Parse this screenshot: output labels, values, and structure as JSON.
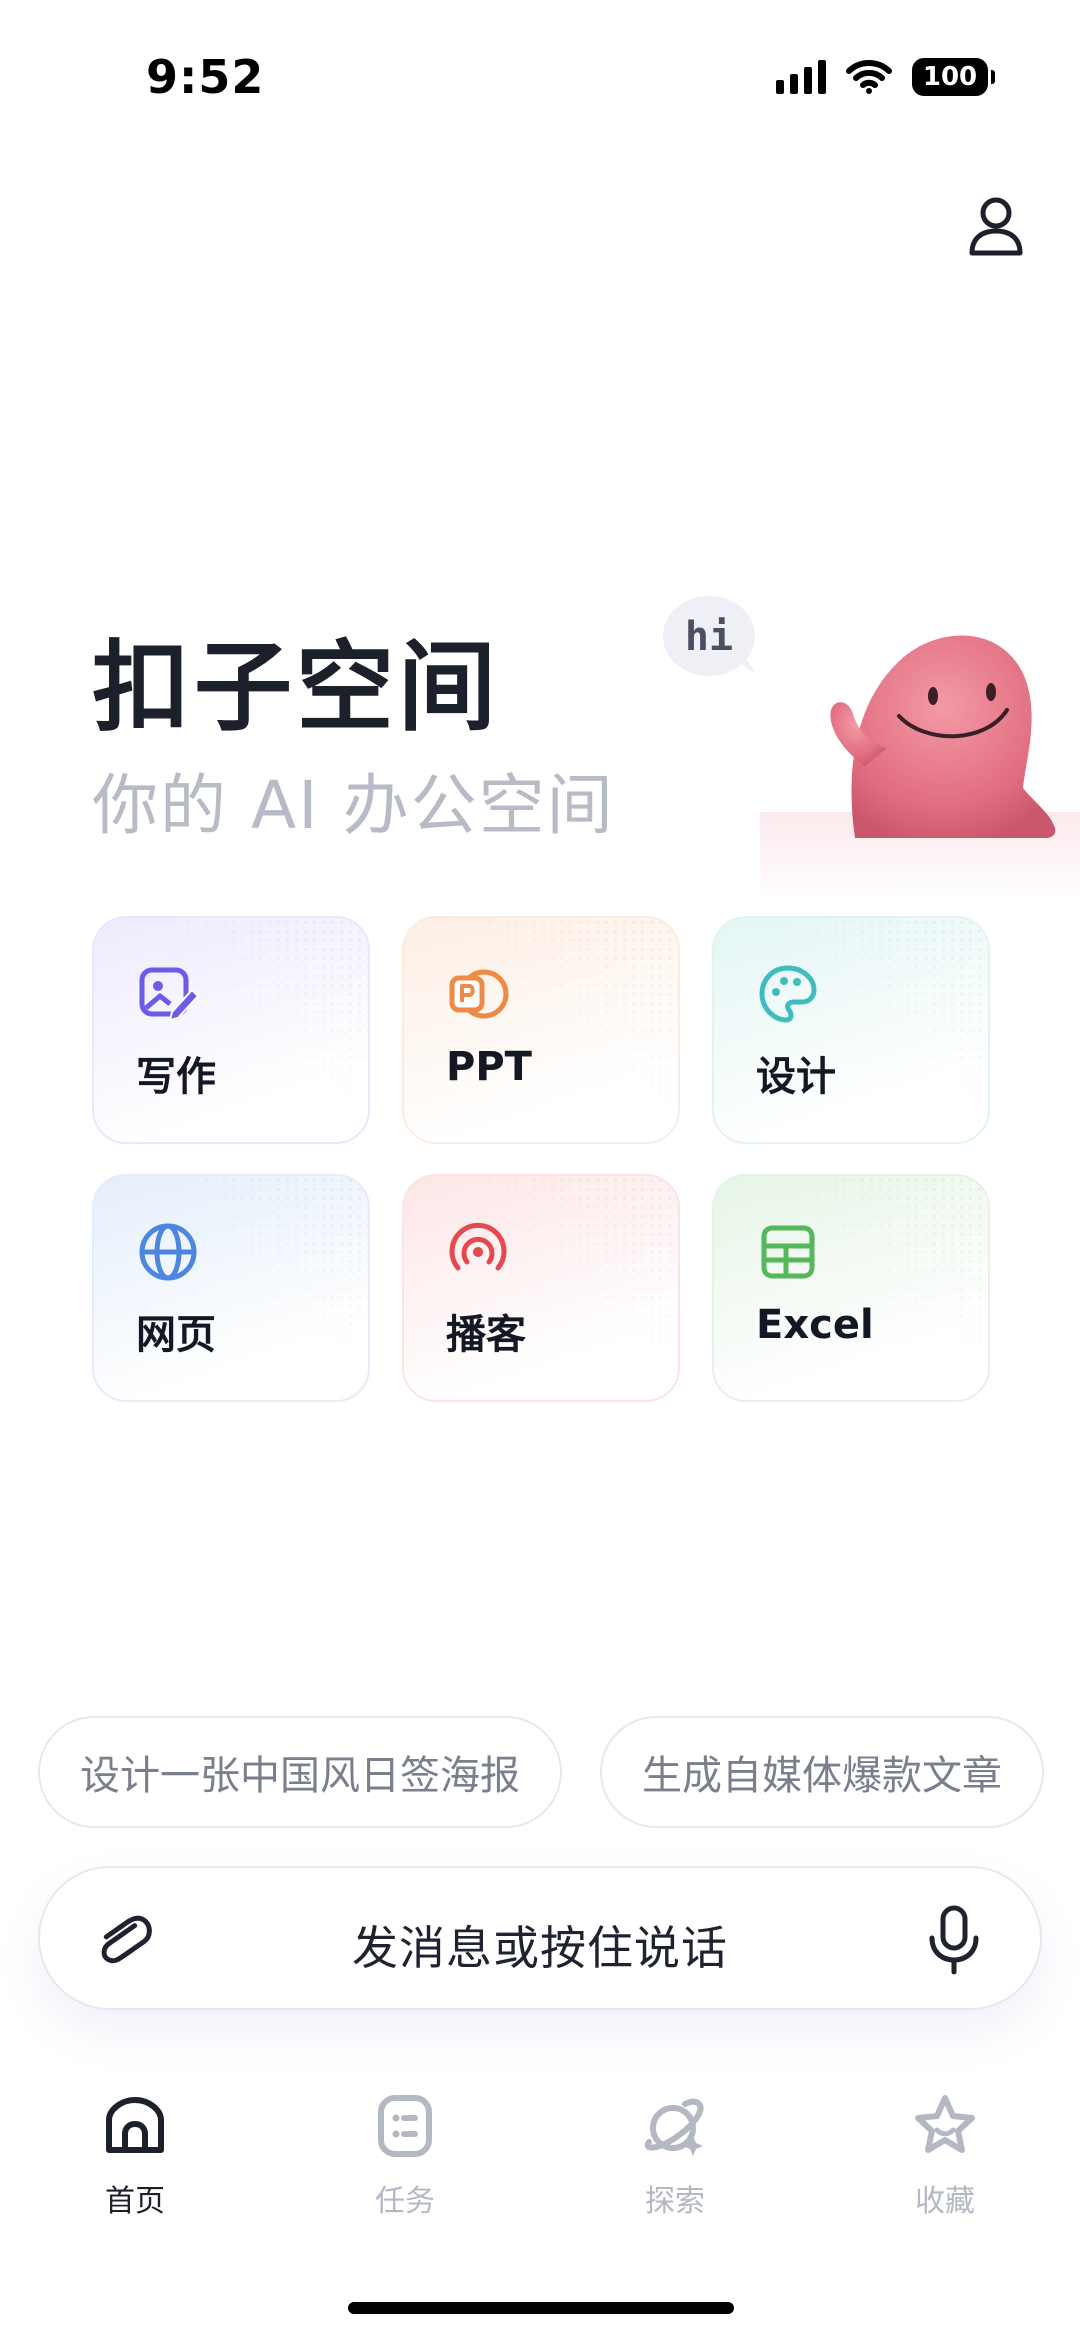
{
  "status_bar": {
    "time": "9:52",
    "battery": "100"
  },
  "hero": {
    "title": "扣子空间",
    "subtitle": "你的 AI 办公空间",
    "mascot_bubble": "hi"
  },
  "features": [
    {
      "label": "写作",
      "icon": "image-edit-icon",
      "color": "#6b5ce7"
    },
    {
      "label": "PPT",
      "icon": "powerpoint-icon",
      "color": "#ee8a45"
    },
    {
      "label": "设计",
      "icon": "palette-icon",
      "color": "#3fbcc0"
    },
    {
      "label": "网页",
      "icon": "globe-icon",
      "color": "#4c86e0"
    },
    {
      "label": "播客",
      "icon": "podcast-icon",
      "color": "#e5484d"
    },
    {
      "label": "Excel",
      "icon": "spreadsheet-icon",
      "color": "#55b85a"
    }
  ],
  "suggestions": [
    "设计一张中国风日签海报",
    "生成自媒体爆款文章"
  ],
  "input": {
    "placeholder": "发消息或按住说话"
  },
  "tabs": [
    {
      "label": "首页",
      "icon": "home-icon",
      "active": true
    },
    {
      "label": "任务",
      "icon": "task-icon",
      "active": false
    },
    {
      "label": "探索",
      "icon": "explore-planet-icon",
      "active": false
    },
    {
      "label": "收藏",
      "icon": "star-icon",
      "active": false
    }
  ]
}
